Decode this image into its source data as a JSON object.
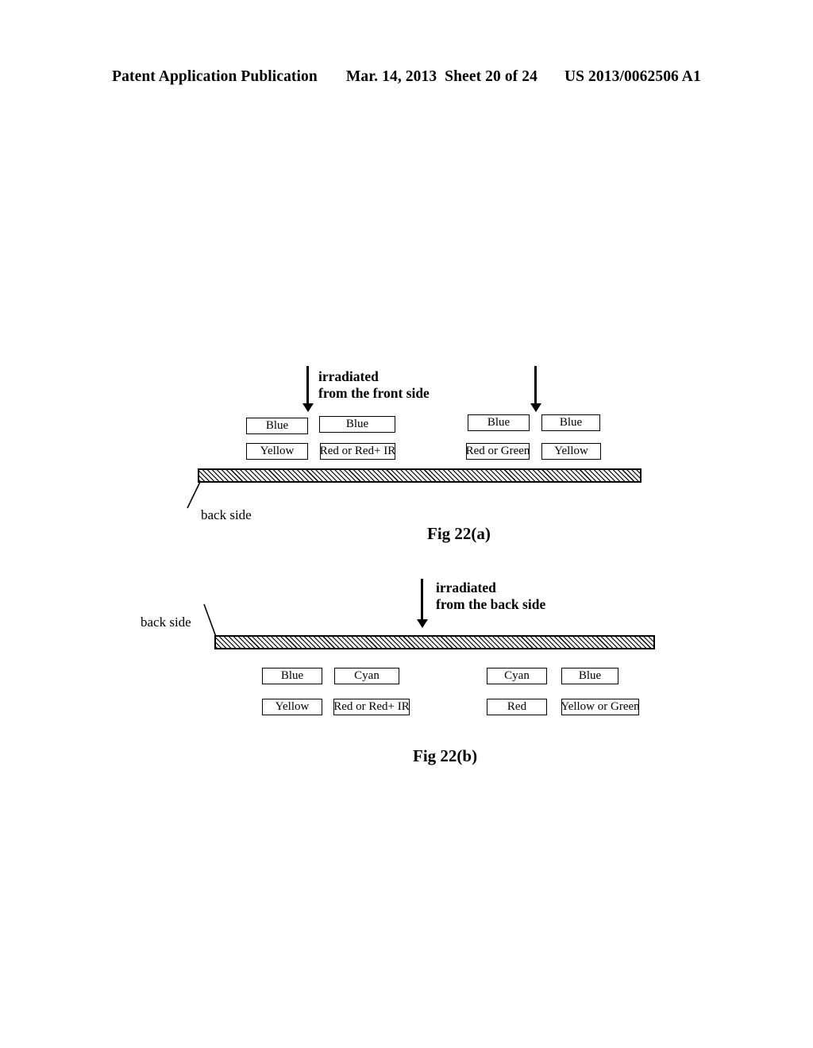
{
  "header": {
    "publication": "Patent Application Publication",
    "date": "Mar. 14, 2013",
    "sheet": "Sheet 20 of 24",
    "number": "US 2013/0062506 A1"
  },
  "figures": [
    {
      "id": "fig-a",
      "caption": "Fig 22(a)",
      "irradiation_caption_line1": "irradiated",
      "irradiation_caption_line2": "from the front side",
      "backside_label": "back side",
      "boxes_top": [
        {
          "label": "Blue"
        },
        {
          "label": "Blue"
        },
        {
          "label": "Blue"
        },
        {
          "label": "Blue"
        }
      ],
      "boxes_bottom": [
        {
          "label": "Yellow"
        },
        {
          "label": "Red or Red+ IR"
        },
        {
          "label": "Red or Green"
        },
        {
          "label": "Yellow"
        }
      ]
    },
    {
      "id": "fig-b",
      "caption": "Fig 22(b)",
      "irradiation_caption_line1": "irradiated",
      "irradiation_caption_line2": "from the back side",
      "backside_label": "back side",
      "boxes_top": [
        {
          "label": "Blue"
        },
        {
          "label": "Cyan"
        },
        {
          "label": "Cyan"
        },
        {
          "label": "Blue"
        }
      ],
      "boxes_bottom": [
        {
          "label": "Yellow"
        },
        {
          "label": "Red or Red+ IR"
        },
        {
          "label": "Red"
        },
        {
          "label": "Yellow or Green"
        }
      ]
    }
  ]
}
